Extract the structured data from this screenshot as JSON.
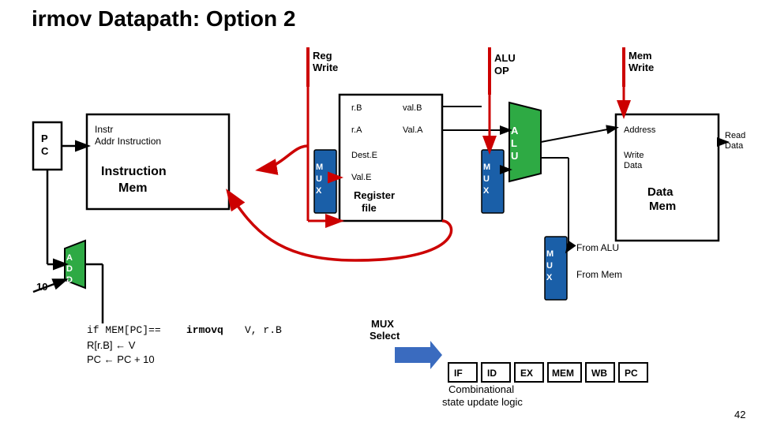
{
  "title": "irmov Datapath: Option 2",
  "diagram": {
    "reg_write_label": "Reg\nWrite",
    "alu_op_label": "ALU\nOP",
    "mem_write_label": "Mem\nWrite",
    "pc_label": "P\nC",
    "instr_label": "Instr",
    "addr_label": "Addr",
    "instruction_label": "Instruction",
    "mem_label": "Mem",
    "rb_label": "r.B",
    "ra_label": "r.A",
    "valb_label": "val.B",
    "vala_label": "Val.A",
    "dest_e_label": "Dest.E",
    "val_e_label": "Val.E",
    "register_file_label": "Register\nfile",
    "mux_label": "M\nU\nX",
    "alu_label": "A\nL\nU",
    "mux2_label": "M\nU\nX",
    "address_label": "Address",
    "write_data_label": "Write\nData",
    "data_mem_label": "Data\nMem",
    "read_data_label": "Read\nData",
    "add_label": "A\nDD",
    "ten_label": "10",
    "from_alu_label": "From ALU",
    "from_mem_label": "From Mem",
    "mux_select_label": "MUX\nSelect",
    "if_label": "IF",
    "id_label": "ID",
    "ex_label": "EX",
    "mem_stage_label": "MEM",
    "wb_label": "WB",
    "pc_stage_label": "PC",
    "combinational_label": "Combinational\nstate update logic",
    "code_line1": "if MEM[PC]== irmovq V, r.B",
    "code_line2": "R[r.B] ← V",
    "code_line3": "PC ← PC + 10",
    "page_number": "42"
  }
}
